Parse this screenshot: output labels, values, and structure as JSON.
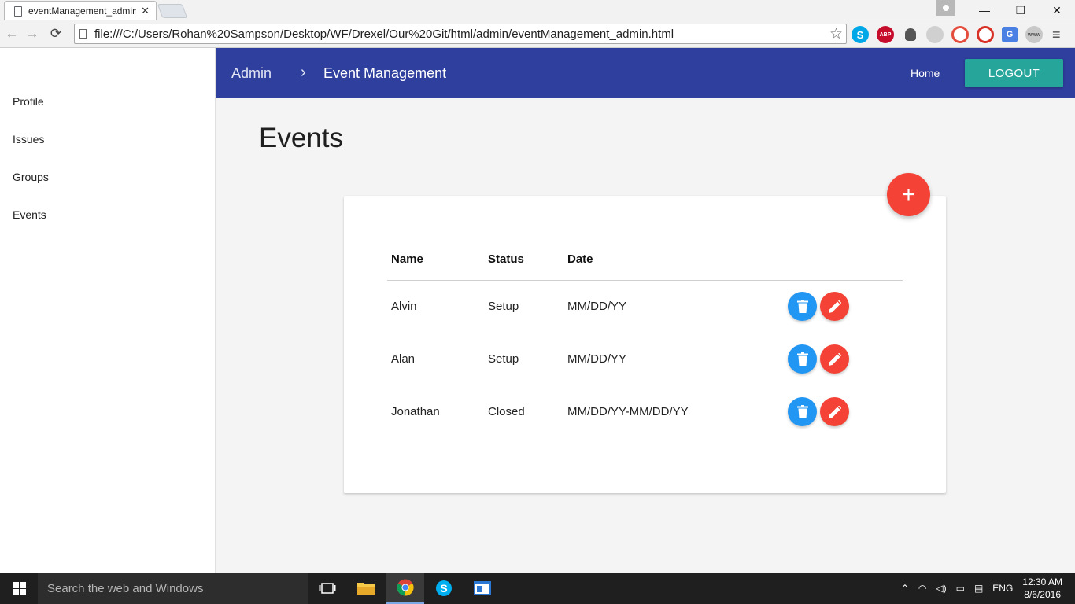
{
  "browser": {
    "tab_title": "eventManagement_admin",
    "tab_close": "✕",
    "url": "file:///C:/Users/Rohan%20Sampson/Desktop/WF/Drexel/Our%20Git/html/admin/eventManagement_admin.html",
    "window_controls": {
      "minimize": "—",
      "restore": "❐",
      "close": "✕"
    },
    "nav": {
      "back": "←",
      "forward": "→",
      "reload": "⟳",
      "bookmark_star": "☆",
      "menu": "≡"
    },
    "extensions": [
      "skype-icon",
      "adblock-plus-icon",
      "lightbulb-icon",
      "refresh-extension-icon",
      "no-tracking-icon",
      "target-icon",
      "google-translate-icon",
      "www-icon"
    ],
    "extension_labels": {
      "skype": "S",
      "abp": "ABP",
      "gtrans": "G",
      "www": "www"
    }
  },
  "sidebar": {
    "items": [
      {
        "label": "Profile"
      },
      {
        "label": "Issues"
      },
      {
        "label": "Groups"
      },
      {
        "label": "Events"
      }
    ]
  },
  "appbar": {
    "breadcrumb_root": "Admin",
    "breadcrumb_separator": "›",
    "breadcrumb_current": "Event Management",
    "home_label": "Home",
    "logout_label": "LOGOUT",
    "color": "#2f3f9e",
    "logout_color": "#26a69a"
  },
  "main": {
    "title": "Events",
    "add_button_label": "+",
    "table": {
      "headers": [
        "Name",
        "Status",
        "Date"
      ],
      "rows": [
        {
          "name": "Alvin",
          "status": "Setup",
          "date": "MM/DD/YY"
        },
        {
          "name": "Alan",
          "status": "Setup",
          "date": "MM/DD/YY"
        },
        {
          "name": "Jonathan",
          "status": "Closed",
          "date": "MM/DD/YY-MM/DD/YY"
        }
      ]
    },
    "delete_button_color": "#2196f3",
    "edit_button_color": "#f44336"
  },
  "taskbar": {
    "search_placeholder": "Search the web and Windows",
    "apps": [
      "task-view-icon",
      "file-explorer-icon",
      "chrome-icon",
      "skype-icon",
      "app-window-icon"
    ],
    "language": "ENG",
    "time": "12:30 AM",
    "date": "8/6/2016"
  }
}
